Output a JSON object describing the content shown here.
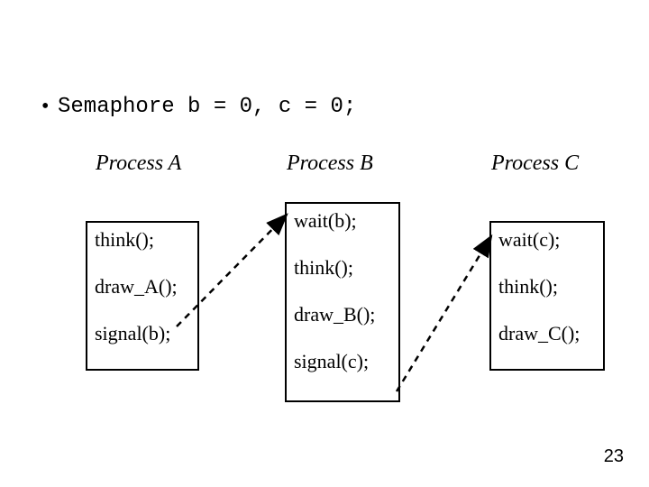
{
  "bullet_line": "Semaphore b = 0, c = 0;",
  "processes": {
    "A": {
      "title": "Process A",
      "lines": [
        "think();",
        "",
        "draw_A();",
        "",
        "signal(b);"
      ]
    },
    "B": {
      "title": "Process B",
      "lines": [
        "wait(b);",
        "",
        "think();",
        "",
        "draw_B();",
        "",
        "signal(c);"
      ]
    },
    "C": {
      "title": "Process C",
      "lines": [
        "wait(c);",
        "",
        "think();",
        "",
        "draw_C();"
      ]
    }
  },
  "page_number": "23"
}
